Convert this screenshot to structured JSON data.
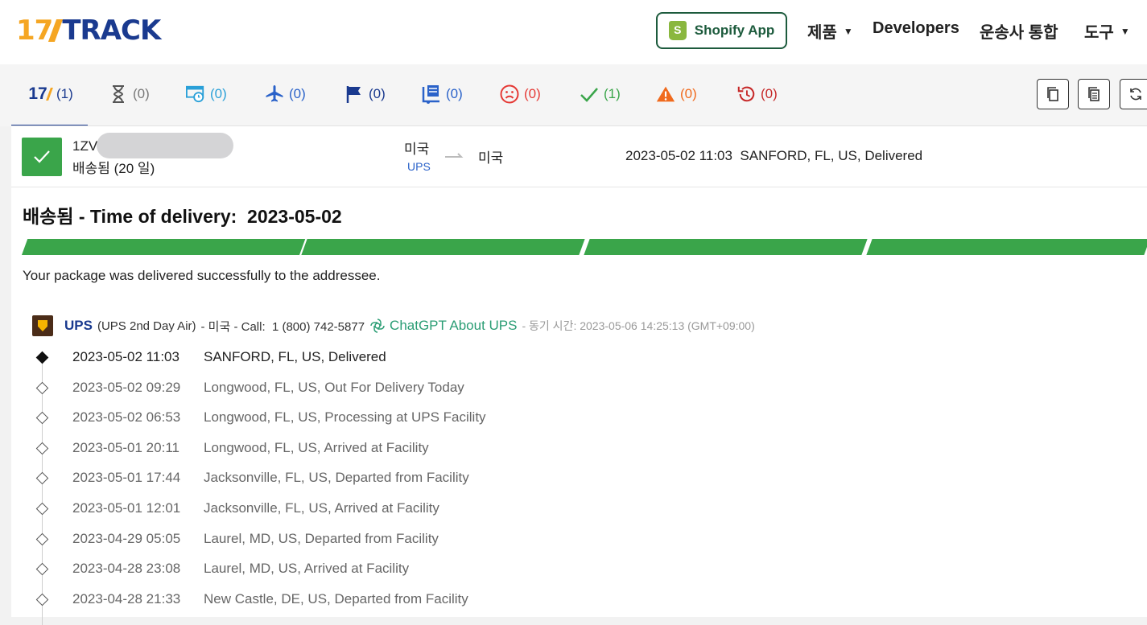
{
  "header": {
    "logo_num": "17",
    "logo_word": "TRACK",
    "shopify_label": "Shopify App",
    "nav": [
      {
        "label": "제품",
        "dropdown": true
      },
      {
        "label": "Developers",
        "dropdown": false
      },
      {
        "label": "운송사 통합",
        "dropdown": false
      },
      {
        "label": "도구",
        "dropdown": true
      }
    ]
  },
  "tabs": [
    {
      "icon": "17track-logo-icon",
      "count": "(1)",
      "color": "#1a3a8f"
    },
    {
      "icon": "hourglass-icon",
      "count": "(0)",
      "color": "#777777"
    },
    {
      "icon": "truck-clock-icon",
      "count": "(0)",
      "color": "#2aa0d8"
    },
    {
      "icon": "airplane-icon",
      "count": "(0)",
      "color": "#2a62c9"
    },
    {
      "icon": "flag-icon",
      "count": "(0)",
      "color": "#1a3a8f"
    },
    {
      "icon": "package-cart-icon",
      "count": "(0)",
      "color": "#2a62c9"
    },
    {
      "icon": "sad-face-icon",
      "count": "(0)",
      "color": "#e53935"
    },
    {
      "icon": "checkmark-icon",
      "count": "(1)",
      "color": "#3aa54a"
    },
    {
      "icon": "warning-icon",
      "count": "(0)",
      "color": "#f06a1d"
    },
    {
      "icon": "history-icon",
      "count": "(0)",
      "color": "#c62828"
    }
  ],
  "summary": {
    "tracking_prefix": "1ZV",
    "status_days": "배송됨 (20 일)",
    "origin": "미국",
    "carrier": "UPS",
    "destination": "미국",
    "latest_event": "2023-05-02 11:03  SANFORD, FL, US, Delivered"
  },
  "detail": {
    "heading": "배송됨 - Time of delivery:  2023-05-02",
    "progress_complete": 1.0,
    "description": "Your package was delivered successfully to the addressee.",
    "carrier_name": "UPS",
    "service": "(UPS 2nd Day Air)",
    "carrier_info": "- 미국 - Call:  1 (800) 742-5877",
    "chatgpt": "ChatGPT About UPS",
    "sync": "- 동기 시간: 2023-05-06 14:25:13 (GMT+09:00)"
  },
  "events": [
    {
      "time": "2023-05-02 11:03",
      "event": "SANFORD, FL, US, Delivered"
    },
    {
      "time": "2023-05-02 09:29",
      "event": "Longwood, FL, US, Out For Delivery Today"
    },
    {
      "time": "2023-05-02 06:53",
      "event": "Longwood, FL, US, Processing at UPS Facility"
    },
    {
      "time": "2023-05-01 20:11",
      "event": "Longwood, FL, US, Arrived at Facility"
    },
    {
      "time": "2023-05-01 17:44",
      "event": "Jacksonville, FL, US, Departed from Facility"
    },
    {
      "time": "2023-05-01 12:01",
      "event": "Jacksonville, FL, US, Arrived at Facility"
    },
    {
      "time": "2023-04-29 05:05",
      "event": "Laurel, MD, US, Departed from Facility"
    },
    {
      "time": "2023-04-28 23:08",
      "event": "Laurel, MD, US, Arrived at Facility"
    },
    {
      "time": "2023-04-28 21:33",
      "event": "New Castle, DE, US, Departed from Facility"
    }
  ],
  "colors": {
    "brand_orange": "#f5a623",
    "brand_blue": "#1a3a8f",
    "delivered_green": "#3aa54a",
    "chatgpt_green": "#2a9d74"
  }
}
